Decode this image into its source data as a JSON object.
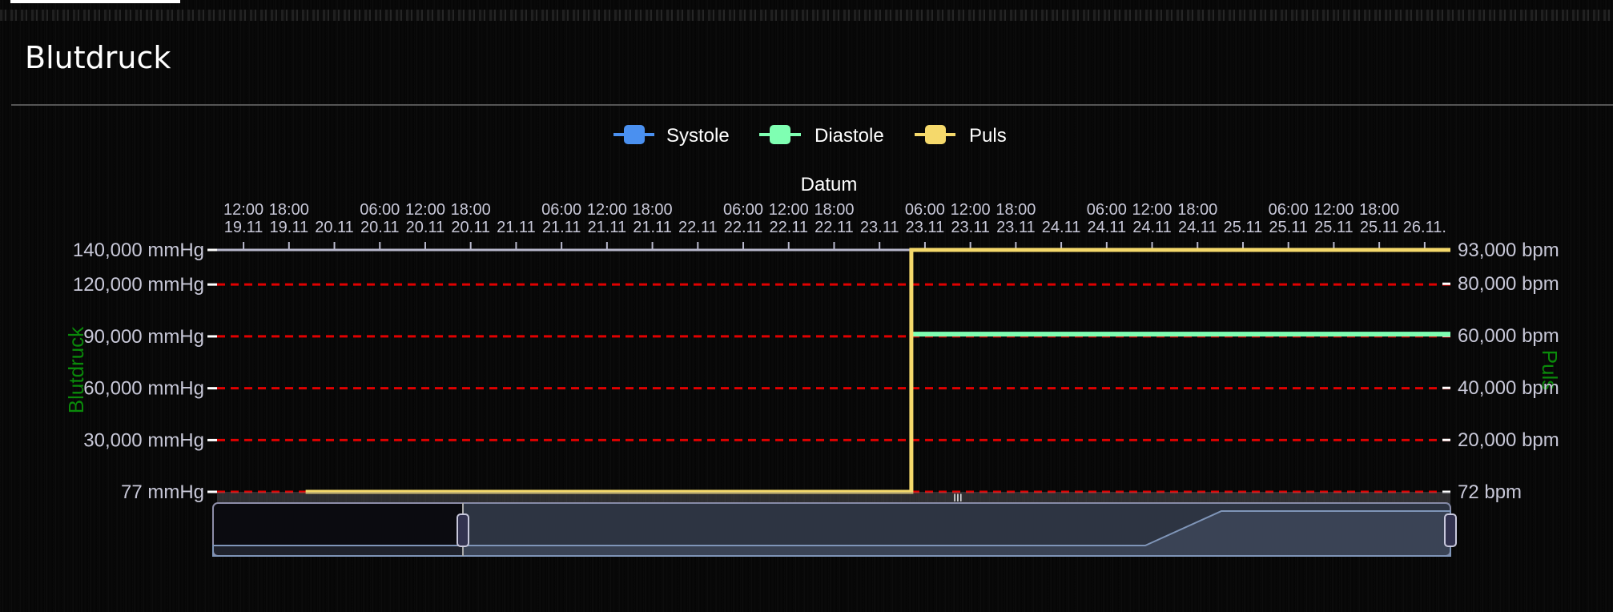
{
  "card": {
    "title": "Blutdruck"
  },
  "colors": {
    "systole": "#4a90f0",
    "diastole": "#7fffb2",
    "puls": "#f5d96b",
    "grid": "#e00000",
    "axis_title": "#0a8a0a"
  },
  "chart_data": {
    "type": "line",
    "xlabel": "Datum",
    "x_unit": "hours since 19.11 00:00",
    "xlim": [
      8.5,
      171.4
    ],
    "x_ticks": [
      {
        "h": 12,
        "time": "12:00",
        "date": "19.11"
      },
      {
        "h": 18,
        "time": "18:00",
        "date": "19.11"
      },
      {
        "h": 24,
        "time": "",
        "date": "20.11"
      },
      {
        "h": 30,
        "time": "06:00",
        "date": "20.11"
      },
      {
        "h": 36,
        "time": "12:00",
        "date": "20.11"
      },
      {
        "h": 42,
        "time": "18:00",
        "date": "20.11"
      },
      {
        "h": 48,
        "time": "",
        "date": "21.11"
      },
      {
        "h": 54,
        "time": "06:00",
        "date": "21.11"
      },
      {
        "h": 60,
        "time": "12:00",
        "date": "21.11"
      },
      {
        "h": 66,
        "time": "18:00",
        "date": "21.11"
      },
      {
        "h": 72,
        "time": "",
        "date": "22.11"
      },
      {
        "h": 78,
        "time": "06:00",
        "date": "22.11"
      },
      {
        "h": 84,
        "time": "12:00",
        "date": "22.11"
      },
      {
        "h": 90,
        "time": "18:00",
        "date": "22.11"
      },
      {
        "h": 96,
        "time": "",
        "date": "23.11"
      },
      {
        "h": 102,
        "time": "06:00",
        "date": "23.11"
      },
      {
        "h": 108,
        "time": "12:00",
        "date": "23.11"
      },
      {
        "h": 114,
        "time": "18:00",
        "date": "23.11"
      },
      {
        "h": 120,
        "time": "",
        "date": "24.11"
      },
      {
        "h": 126,
        "time": "06:00",
        "date": "24.11"
      },
      {
        "h": 132,
        "time": "12:00",
        "date": "24.11"
      },
      {
        "h": 138,
        "time": "18:00",
        "date": "24.11"
      },
      {
        "h": 144,
        "time": "",
        "date": "25.11"
      },
      {
        "h": 150,
        "time": "06:00",
        "date": "25.11"
      },
      {
        "h": 156,
        "time": "12:00",
        "date": "25.11"
      },
      {
        "h": 162,
        "time": "18:00",
        "date": "25.11"
      },
      {
        "h": 168,
        "time": "",
        "date": "26.11."
      }
    ],
    "y_left": {
      "label": "Blutdruck",
      "min": 77,
      "max": 140000,
      "ticks": [
        {
          "v": 140000,
          "t": "140,000 mmHg"
        },
        {
          "v": 120000,
          "t": "120,000 mmHg"
        },
        {
          "v": 90000,
          "t": "90,000 mmHg"
        },
        {
          "v": 60000,
          "t": "60,000 mmHg"
        },
        {
          "v": 30000,
          "t": "30,000 mmHg"
        },
        {
          "v": 77,
          "t": "77 mmHg"
        }
      ]
    },
    "y_right": {
      "label": "Puls",
      "min": 72,
      "max": 93000,
      "ticks": [
        {
          "v": 93000,
          "t": "93,000 bpm"
        },
        {
          "v": 80000,
          "t": "80,000 bpm"
        },
        {
          "v": 60000,
          "t": "60,000 bpm"
        },
        {
          "v": 40000,
          "t": "40,000 bpm"
        },
        {
          "v": 20000,
          "t": "20,000 bpm"
        },
        {
          "v": 72,
          "t": "72 bpm"
        }
      ]
    },
    "grid": true,
    "legend": {
      "placement": "top-center",
      "items": [
        "Systole",
        "Diastole",
        "Puls"
      ]
    },
    "series": [
      {
        "name": "Systole",
        "axis": "left",
        "x": [
          100.2,
          171.4
        ],
        "y": [
          140000,
          140000
        ]
      },
      {
        "name": "Diastole",
        "axis": "left",
        "x": [
          100.2,
          171.4
        ],
        "y": [
          91300,
          91300
        ]
      },
      {
        "name": "Puls",
        "axis": "right",
        "x": [
          20.2,
          100.2,
          100.2,
          171.4
        ],
        "y": [
          72,
          72,
          93000,
          93000
        ]
      }
    ],
    "navigator": {
      "selection_start": 0.2,
      "selection_end": 1.0
    }
  }
}
